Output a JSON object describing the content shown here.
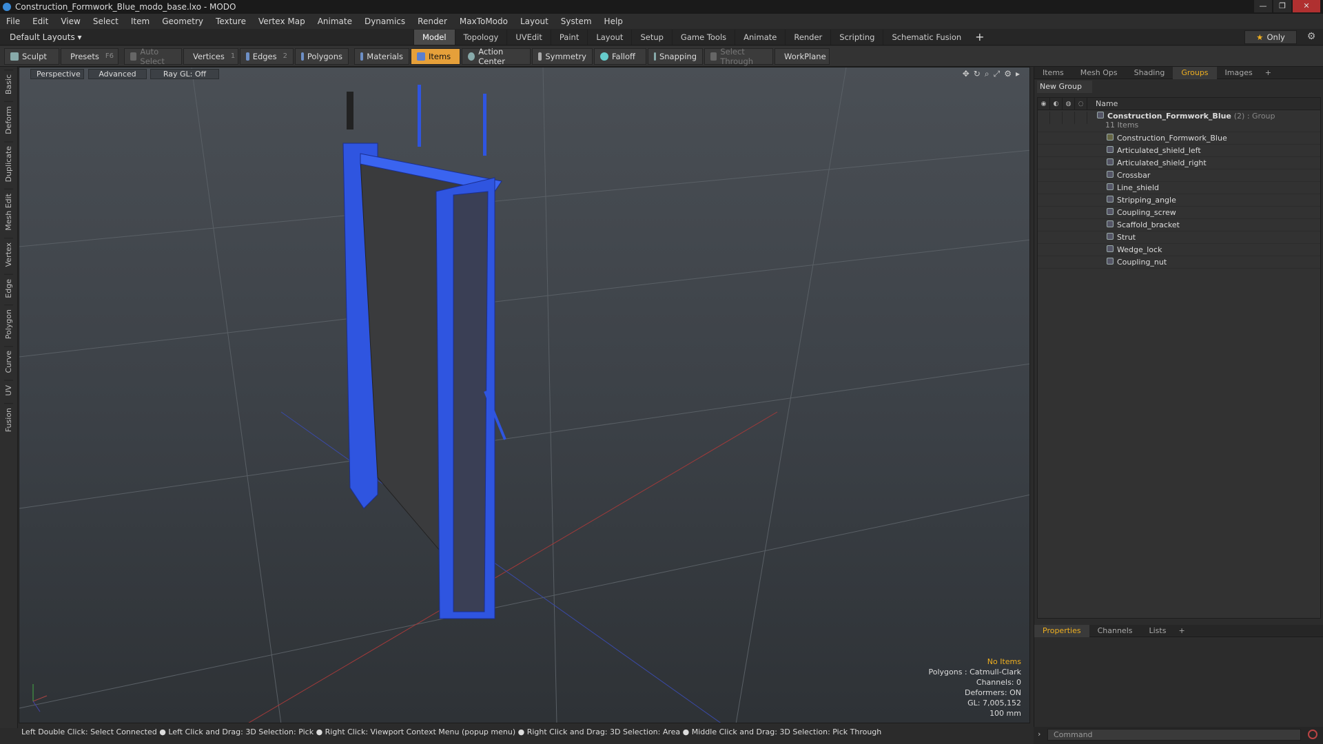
{
  "window": {
    "title": "Construction_Formwork_Blue_modo_base.lxo - MODO",
    "controls": [
      "—",
      "❐",
      "✕"
    ]
  },
  "menu": [
    "File",
    "Edit",
    "View",
    "Select",
    "Item",
    "Geometry",
    "Texture",
    "Vertex Map",
    "Animate",
    "Dynamics",
    "Render",
    "MaxToModo",
    "Layout",
    "System",
    "Help"
  ],
  "layoutbar": {
    "default_layouts": "Default Layouts ▾",
    "tabs": [
      "Model",
      "Topology",
      "UVEdit",
      "Paint",
      "Layout",
      "Setup",
      "Game Tools",
      "Animate",
      "Render",
      "Scripting",
      "Schematic Fusion"
    ],
    "active": "Model",
    "plus": "+",
    "only": "Only"
  },
  "toolbar": {
    "sculpt": "Sculpt",
    "presets": "Presets",
    "presets_key": "F6",
    "auto_select": "Auto Select",
    "vertices": "Vertices",
    "vertices_key": "1",
    "edges": "Edges",
    "edges_key": "2",
    "polygons": "Polygons",
    "materials": "Materials",
    "items": "Items",
    "action_center": "Action Center",
    "symmetry": "Symmetry",
    "falloff": "Falloff",
    "snapping": "Snapping",
    "select_through": "Select Through",
    "workplane": "WorkPlane"
  },
  "left_tabs": [
    "Basic",
    "Deform",
    "Duplicate",
    "Mesh Edit",
    "Vertex",
    "Edge",
    "Polygon",
    "Curve",
    "UV",
    "Fusion"
  ],
  "viewport": {
    "view": "Perspective",
    "shading": "Advanced",
    "raygl": "Ray GL: Off",
    "info": {
      "selection": "No Items",
      "polygons": "Polygons : Catmull-Clark",
      "channels": "Channels: 0",
      "deformers": "Deformers: ON",
      "gl": "GL: 7,005,152",
      "scale": "100 mm"
    }
  },
  "status": "Left Double Click: Select Connected ● Left Click and Drag: 3D Selection: Pick ● Right Click: Viewport Context Menu (popup menu) ● Right Click and Drag: 3D Selection: Area ● Middle Click and Drag: 3D Selection: Pick Through",
  "right_panel": {
    "tabs": [
      "Items",
      "Mesh Ops",
      "Shading",
      "Groups",
      "Images"
    ],
    "active": "Groups",
    "plus": "+",
    "new_group": "New Group",
    "name_header": "Name",
    "group": {
      "name": "Construction_Formwork_Blue",
      "suffix": "(2) : Group",
      "count": "11 Items"
    },
    "items": [
      "Construction_Formwork_Blue",
      "Articulated_shield_left",
      "Articulated_shield_right",
      "Crossbar",
      "Line_shield",
      "Stripping_angle",
      "Coupling_screw",
      "Scaffold_bracket",
      "Strut",
      "Wedge_lock",
      "Coupling_nut"
    ]
  },
  "props_panel": {
    "tabs": [
      "Properties",
      "Channels",
      "Lists"
    ],
    "active": "Properties",
    "plus": "+"
  },
  "command": {
    "placeholder": "Command"
  },
  "colors": {
    "accent": "#f0b020",
    "mesh_blue": "#2f55e0",
    "toolbar_active": "#e6a03a"
  }
}
